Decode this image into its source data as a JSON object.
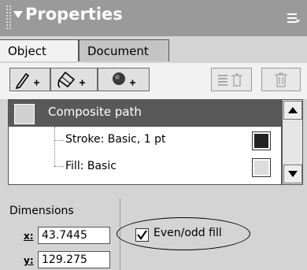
{
  "panel": {
    "title": "Properties"
  },
  "tabs": [
    {
      "label": "Object",
      "active": true
    },
    {
      "label": "Document",
      "active": false
    }
  ],
  "toolbar": {
    "buttons": [
      "add-stroke-icon",
      "add-fill-icon",
      "add-effect-icon",
      "delete-attribute-icon",
      "trash-icon"
    ]
  },
  "attributes": {
    "items": [
      {
        "label": "Composite path",
        "selected": true
      },
      {
        "label": "Stroke: Basic, 1 pt",
        "swatch": "#222222"
      },
      {
        "label": "Fill: Basic",
        "swatch": "#dddddd"
      }
    ]
  },
  "dimensions": {
    "label": "Dimensions",
    "x_label": "x:",
    "x_value": "43.7445",
    "y_label": "y:",
    "y_value": "129.275"
  },
  "options": {
    "evenodd_label": "Even/odd fill",
    "evenodd_checked": true
  }
}
